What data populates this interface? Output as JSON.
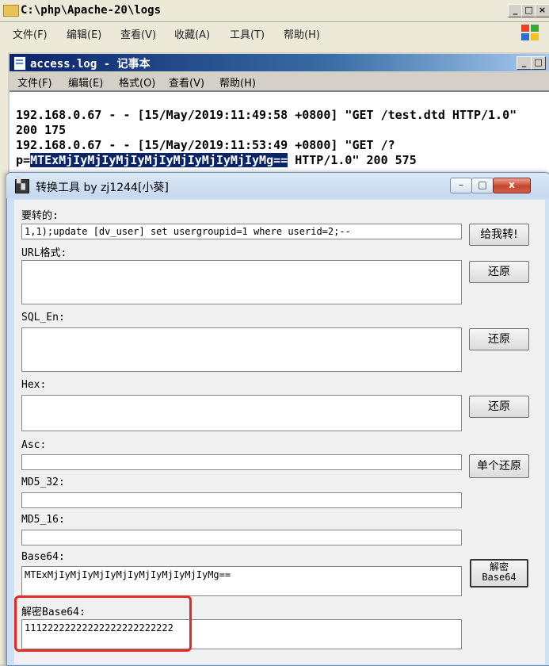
{
  "explorer": {
    "title": "C:\\php\\Apache-20\\logs",
    "menu": [
      "文件(F)",
      "编辑(E)",
      "查看(V)",
      "收藏(A)",
      "工具(T)",
      "帮助(H)"
    ],
    "buttons": {
      "min": "_",
      "max": "□",
      "close": "×"
    }
  },
  "notepad": {
    "title": "access.log - 记事本",
    "menu": [
      "文件(F)",
      "编辑(E)",
      "格式(O)",
      "查看(V)",
      "帮助(H)"
    ],
    "buttons": {
      "min": "_",
      "max": "□"
    },
    "lines": {
      "l1": "192.168.0.67 - - [15/May/2019:11:49:58 +0800] \"GET /test.dtd HTTP/1.0\"",
      "l2": "200 175",
      "l3": "192.168.0.67 - - [15/May/2019:11:53:49 +0800] \"GET /?",
      "l4_prefix": "p=",
      "l4_selected": "MTExMjIyMjIyMjIyMjIyMjIyMjIyMjIyMg==",
      "l4_suffix": " HTTP/1.0\" 200 575"
    }
  },
  "tool": {
    "title": "转换工具 by zj1244[小葵]",
    "caption": {
      "min": "–",
      "max": "□",
      "close": "x"
    },
    "input_label": "要转的:",
    "input_value": "1,1);update [dv_user] set usergroupid=1 where userid=2;--",
    "convert_button": "给我转!",
    "url_label": "URL格式:",
    "url_value": "",
    "sql_label": "SQL_En:",
    "sql_value": "",
    "hex_label": "Hex:",
    "hex_value": "",
    "asc_label": "Asc:",
    "asc_value": "",
    "md5_32_label": "MD5_32:",
    "md5_32_value": "",
    "md5_16_label": "MD5_16:",
    "md5_16_value": "",
    "base64_label": "Base64:",
    "base64_value": "MTExMjIyMjIyMjIyMjIyMjIyMjIyMjIyMg==",
    "decoded_label": "解密Base64:",
    "decoded_value": "11122222222222222222222222",
    "restore_button": "还原",
    "single_restore_button": "单个还原",
    "decrypt_button_line1": "解密",
    "decrypt_button_line2": "Base64"
  },
  "colors": {
    "highlight": "#e42a23",
    "selection": "#0a246a",
    "notepad_title": "#0a246a"
  }
}
